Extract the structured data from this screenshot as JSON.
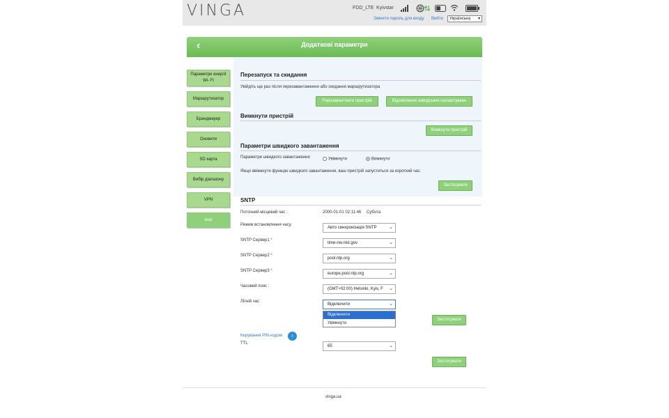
{
  "brand": {
    "logo": "VINGA"
  },
  "status": {
    "network": "FDD_LTE",
    "operator": "Kyivstar",
    "change_password": "Змінити пароль для входу",
    "logout": "Вийти",
    "language": "Українська"
  },
  "header": {
    "title": "Додаткові параметри"
  },
  "sidebar": {
    "items": [
      {
        "label": "Параметри енергії Wi- Fi"
      },
      {
        "label": "Маршрутизатор"
      },
      {
        "label": "Брандмауер"
      },
      {
        "label": "Оновити"
      },
      {
        "label": "SD карта"
      },
      {
        "label": "Вибір діапазону"
      },
      {
        "label": "VPN"
      },
      {
        "label": "Інші"
      }
    ]
  },
  "restart": {
    "title": "Перезапуск та скидання",
    "desc": "Увійдіть ще раз після перезавантаження або скидання маршрутизатора",
    "reboot_btn": "Перезавантажте пристрій",
    "reset_btn": "Відновлення заводських налаштувань"
  },
  "shutdown": {
    "title": "Вимкнути пристрій",
    "btn": "Вимкнути пристрій"
  },
  "fastboot": {
    "title": "Параметри швидкого завантаження",
    "label": "Параметри швидкого завантаження",
    "on": "Увімкнути",
    "off": "Вимкнути",
    "note": "Якщо ввімкнути функцію швидкого завантаження, ваш пристрій запуститься за короткий час.",
    "apply": "Застосувати"
  },
  "sntp": {
    "title": "SNTP",
    "local_time_label": "Поточний місцевий час :",
    "local_time_value": "2000-01-01 02:11:46",
    "day": "Субота",
    "mode_label": "Режим встановлення часу",
    "mode_value": "Авто синхронізація SNTP",
    "server1_label": "SNTP Сервер1",
    "server1_value": "time-nw.nist.gov",
    "server2_label": "SNTP Сервер2",
    "server2_value": "pool.ntp.org",
    "server3_label": "SNTP Сервер3",
    "server3_value": "europe.pool.ntp.org",
    "tz_label": "Часовий пояс :",
    "tz_value": "(GMT+02:00) Helsinki, Kyiv, F",
    "dst_label": "Літній час",
    "dst_value": "Відключити",
    "dst_options": [
      "Відключити",
      "Увімкнути"
    ],
    "apply": "Застосувати",
    "required": "*"
  },
  "pin": {
    "link": "Керування PIN-кодом"
  },
  "ttl": {
    "label": "TTL",
    "value": "65",
    "apply": "Застосувати"
  },
  "footer": {
    "site": "vinga.ua"
  }
}
